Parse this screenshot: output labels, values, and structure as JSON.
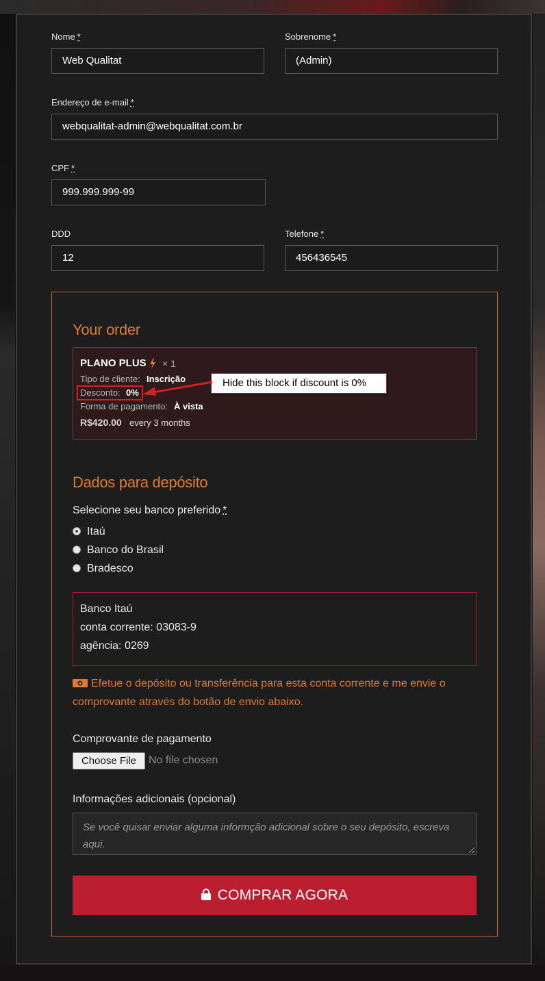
{
  "form": {
    "first_name_label": "Nome",
    "first_name_value": "Web Qualitat",
    "last_name_label": "Sobrenome",
    "last_name_value": "(Admin)",
    "email_label": "Endereço de e-mail",
    "email_value": "webqualitat-admin@webqualitat.com.br",
    "cpf_label": "CPF",
    "cpf_value": "999.999.999-99",
    "ddd_label": "DDD",
    "ddd_value": "12",
    "phone_label": "Telefone",
    "phone_value": "456436545",
    "required_mark": "*"
  },
  "order": {
    "title": "Your order",
    "product_name": "PLANO PLUS",
    "quantity": "× 1",
    "client_type_label": "Tipo de cliente:",
    "client_type_value": "Inscrição",
    "discount_label": "Desconto:",
    "discount_value": "0%",
    "payment_label": "Forma de pagamento:",
    "payment_value": "À vista",
    "price": "R$420.00",
    "period": "every 3 months"
  },
  "deposit": {
    "title": "Dados para depósito",
    "bank_question": "Selecione seu banco preferido",
    "banks": [
      "Itaú",
      "Banco do Brasil",
      "Bradesco"
    ],
    "selected_bank_index": 0,
    "bank_details": [
      "Banco Itaú",
      "conta corrente: 03083-9",
      "agência: 0269"
    ],
    "note": "Efetue o depósito ou transferência para esta conta corrente e me envie o comprovante através do botão de envio abaixo.",
    "note_icon": "money-bill-icon",
    "proof_label": "Comprovante de pagamento",
    "choose_file_label": "Choose File",
    "file_status": "No file chosen",
    "additional_label": "Informações adicionais (opcional)",
    "additional_placeholder": "Se você quisar enviar alguma informção adicional sobre o seu depósito, escreva aqui.",
    "submit_label": "COMPRAR AGORA",
    "submit_icon": "lock-icon"
  },
  "annotation": {
    "text": "Hide this block if discount is 0%"
  },
  "colors": {
    "accent_orange": "#e07a32",
    "button_red": "#bb1e2e",
    "annotation_red": "#d42020"
  }
}
